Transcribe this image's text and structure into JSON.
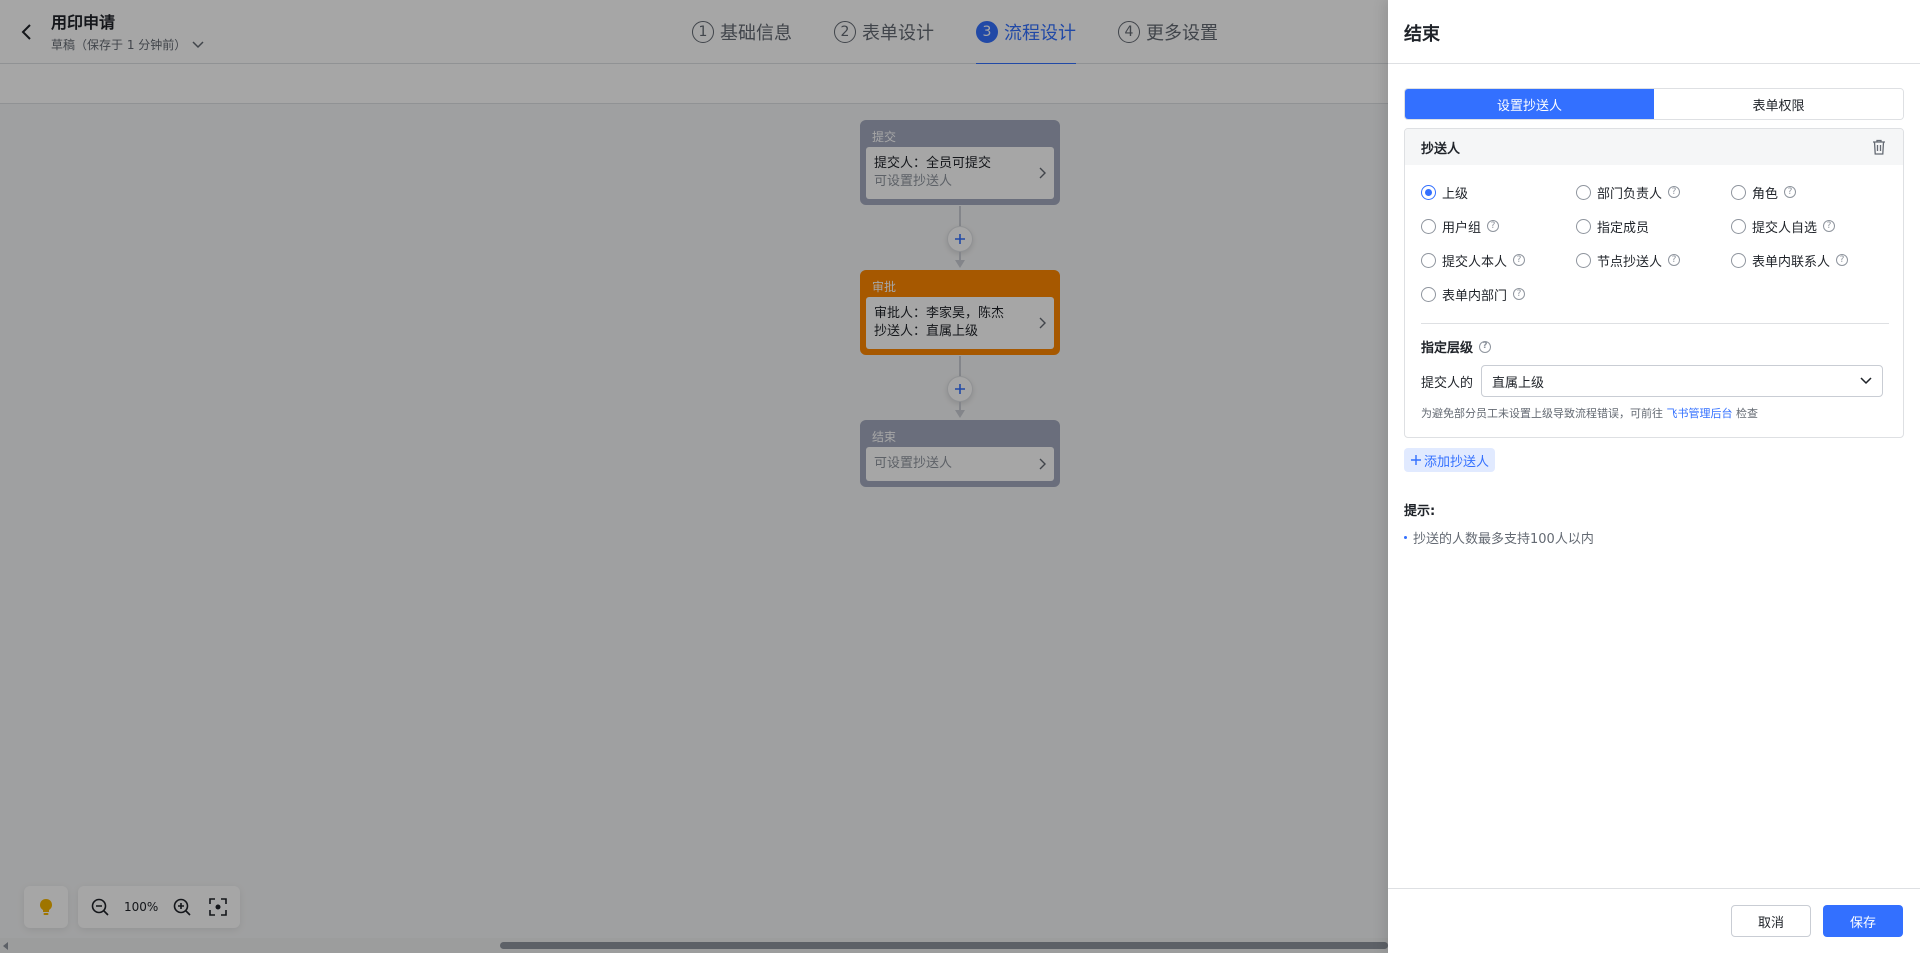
{
  "header": {
    "title": "用印申请",
    "status": "草稿（保存于 1 分钟前）",
    "steps": [
      {
        "num": "1",
        "label": "基础信息"
      },
      {
        "num": "2",
        "label": "表单设计"
      },
      {
        "num": "3",
        "label": "流程设计"
      },
      {
        "num": "4",
        "label": "更多设置"
      }
    ],
    "active_step_index": 2
  },
  "flow": {
    "submit": {
      "head": "提交",
      "line1": "提交人：全员可提交",
      "line2": "可设置抄送人"
    },
    "approve": {
      "head": "审批",
      "line1": "审批人：李家昊，陈杰",
      "line2": "抄送人：直属上级"
    },
    "end": {
      "head": "结束",
      "line1": "可设置抄送人"
    }
  },
  "canvas_tools": {
    "zoom": "100%"
  },
  "drawer": {
    "title": "结束",
    "tabs": [
      "设置抄送人",
      "表单权限"
    ],
    "card_title": "抄送人",
    "options": [
      {
        "label": "上级",
        "help": false,
        "checked": true
      },
      {
        "label": "部门负责人",
        "help": true,
        "checked": false
      },
      {
        "label": "角色",
        "help": true,
        "checked": false
      },
      {
        "label": "用户组",
        "help": true,
        "checked": false
      },
      {
        "label": "指定成员",
        "help": false,
        "checked": false
      },
      {
        "label": "提交人自选",
        "help": true,
        "checked": false
      },
      {
        "label": "提交人本人",
        "help": true,
        "checked": false
      },
      {
        "label": "节点抄送人",
        "help": true,
        "checked": false
      },
      {
        "label": "表单内联系人",
        "help": true,
        "checked": false
      },
      {
        "label": "表单内部门",
        "help": true,
        "checked": false
      }
    ],
    "level_title": "指定层级",
    "level_label": "提交人的",
    "level_value": "直属上级",
    "hint_prefix": "为避免部分员工未设置上级导致流程错误，可前往",
    "hint_link": "飞书管理后台",
    "hint_suffix": "检查",
    "add_cc": "添加抄送人",
    "tips_title": "提示:",
    "tips_item": "抄送的人数最多支持100人以内",
    "cancel": "取消",
    "save": "保存"
  },
  "colors": {
    "accent": "#3370ff",
    "approve_node": "#ff8800",
    "neutral_node": "#a3aabf"
  }
}
